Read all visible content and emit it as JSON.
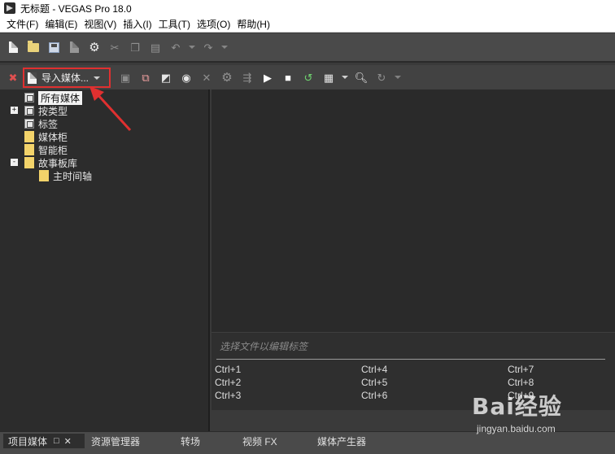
{
  "window": {
    "title": "无标题 - VEGAS Pro 18.0"
  },
  "menu": [
    "文件(F)",
    "编辑(E)",
    "视图(V)",
    "插入(I)",
    "工具(T)",
    "选项(O)",
    "帮助(H)"
  ],
  "main_toolbar": {
    "icons": [
      "new-file-icon",
      "open-folder-icon",
      "save-icon",
      "render-icon",
      "properties-gear-icon",
      "cut-icon",
      "copy-icon",
      "paste-icon",
      "undo-icon",
      "redo-icon"
    ]
  },
  "media_toolbar": {
    "import_label": "导入媒体...",
    "icons": [
      "remove-media-icon",
      "import-media-icon",
      "capture-video-icon",
      "get-media-icon",
      "burn-disc-icon",
      "delete-icon",
      "media-fx-icon",
      "search-media-icon",
      "play-icon",
      "stop-icon",
      "auto-preview-icon",
      "views-icon",
      "zoom-icon",
      "refresh-icon"
    ]
  },
  "tree": {
    "nodes": [
      {
        "label": "所有媒体",
        "selected": true,
        "expander": ""
      },
      {
        "label": "按类型",
        "selected": false,
        "expander": "+"
      },
      {
        "label": "标签",
        "selected": false,
        "expander": ""
      },
      {
        "label": "媒体柜",
        "selected": false,
        "expander": ""
      },
      {
        "label": "智能柜",
        "selected": false,
        "expander": ""
      },
      {
        "label": "故事板库",
        "selected": false,
        "expander": "-"
      },
      {
        "label": "主时间轴",
        "selected": false,
        "expander": ""
      }
    ]
  },
  "tags_panel": {
    "hint": "选择文件以编辑标签",
    "shortcuts": [
      "Ctrl+1",
      "Ctrl+4",
      "Ctrl+7",
      "Ctrl+2",
      "Ctrl+5",
      "Ctrl+8",
      "Ctrl+3",
      "Ctrl+6",
      "Ctrl+9"
    ]
  },
  "tabs": [
    {
      "label": "项目媒体",
      "active": true
    },
    {
      "label": "资源管理器",
      "active": false
    },
    {
      "label": "转场",
      "active": false
    },
    {
      "label": "视频 FX",
      "active": false
    },
    {
      "label": "媒体产生器",
      "active": false
    }
  ],
  "tab_controls": {
    "restore": "□",
    "close": "✕"
  },
  "watermark": {
    "brand": "Bai经验",
    "url": "jingyan.baidu.com"
  },
  "colors": {
    "highlight": "#e03030",
    "folder": "#f3d36a"
  }
}
